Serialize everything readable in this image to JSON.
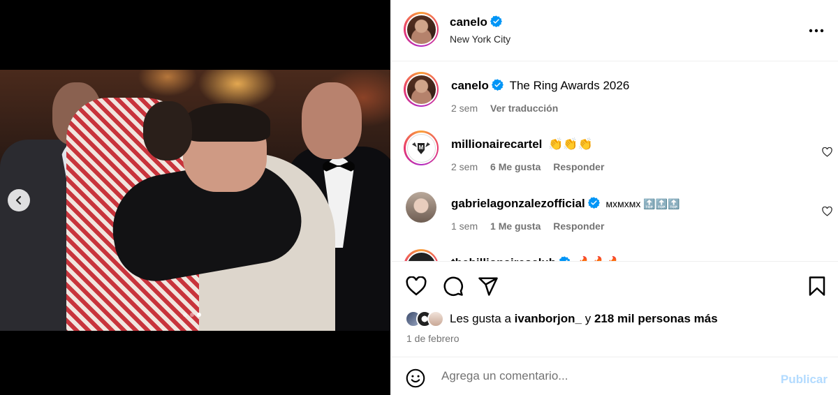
{
  "post": {
    "username": "canelo",
    "location": "New York City",
    "carousel": {
      "total": 3,
      "active": 3
    }
  },
  "caption": {
    "username": "canelo",
    "text": "The Ring Awards 2026",
    "time": "2 sem",
    "translate_label": "Ver traducción"
  },
  "comments": [
    {
      "username": "millionairecartel",
      "verified": false,
      "text": "👏👏👏",
      "time": "2 sem",
      "likes": "6 Me gusta",
      "reply_label": "Responder"
    },
    {
      "username": "gabrielagonzalezofficial",
      "verified": true,
      "text": "ᴍxᴍxᴍx 🔝🔝🔝",
      "time": "1 sem",
      "likes": "1 Me gusta",
      "reply_label": "Responder"
    },
    {
      "username": "thebillionairesclub",
      "verified": true,
      "text": "🔥🔥🔥"
    }
  ],
  "likes": {
    "prefix": "Les gusta a",
    "user": "ivanborjon_",
    "joiner": "y",
    "rest": "218 mil personas más"
  },
  "date": "1 de febrero",
  "composer": {
    "placeholder": "Agrega un comentario...",
    "publish_label": "Publicar"
  },
  "colors": {
    "verified": "#0095f6",
    "publish_disabled": "#b3dbff",
    "meta_gray": "#737373"
  },
  "icons": [
    "chevron-left-icon",
    "more-icon",
    "verified-icon",
    "heart-icon",
    "comment-icon",
    "share-icon",
    "bookmark-icon",
    "emoji-icon"
  ]
}
